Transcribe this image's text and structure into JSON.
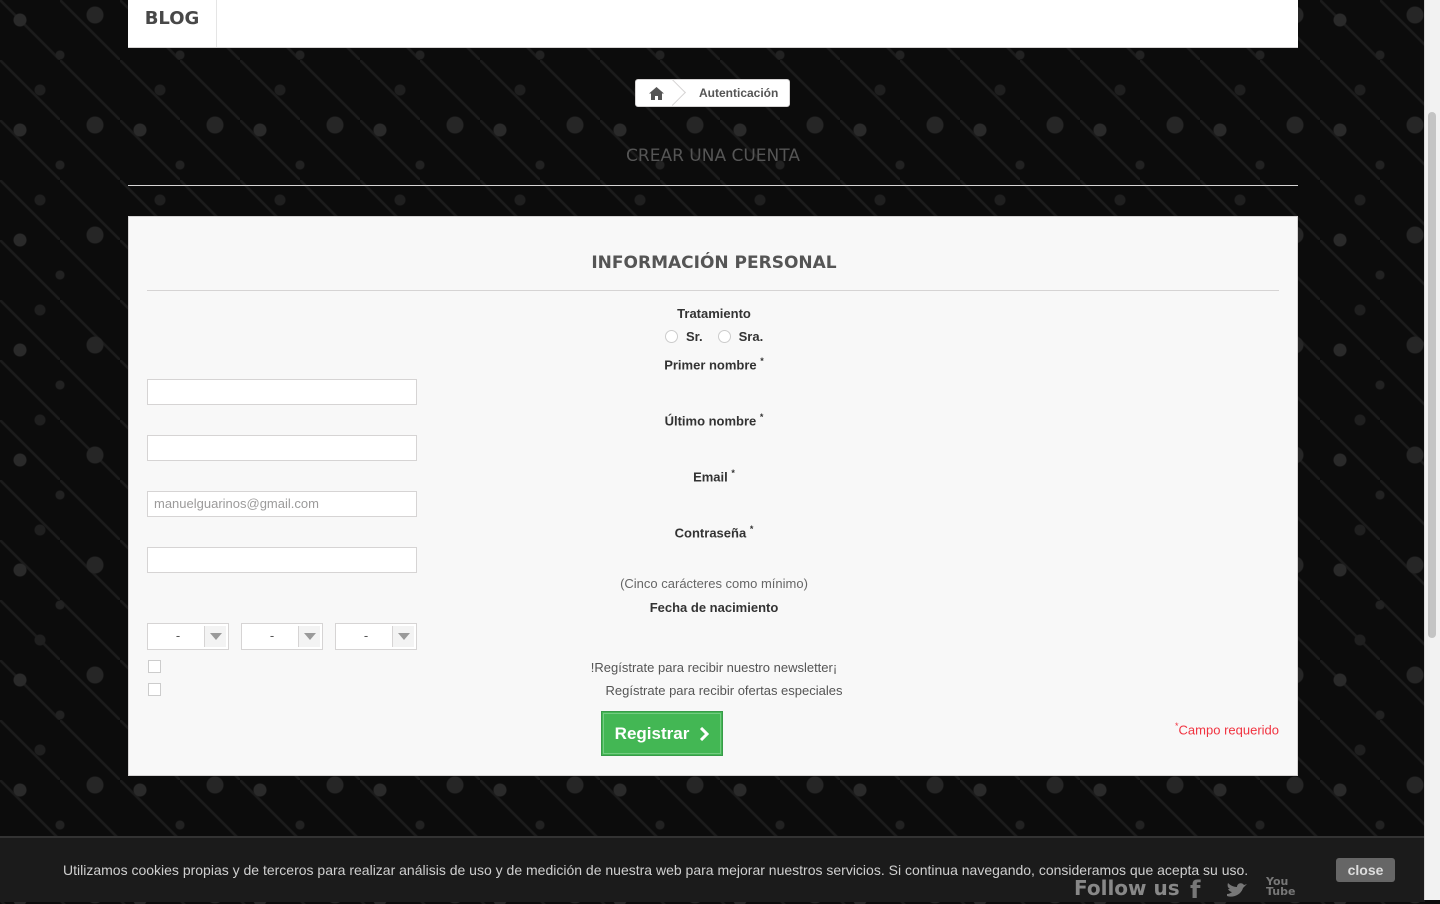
{
  "nav": {
    "blog_label": "BLOG"
  },
  "breadcrumb": {
    "home_icon": "home-icon",
    "current": "Autenticación"
  },
  "page": {
    "heading": "CREAR UNA CUENTA"
  },
  "form": {
    "section_title": "INFORMACIÓN PERSONAL",
    "title_label": "Tratamiento",
    "title_options": [
      "Sr.",
      "Sra."
    ],
    "first_name_label": "Primer nombre",
    "last_name_label": "Último nombre",
    "email_label": "Email",
    "email_value": "manuelguarinos@gmail.com",
    "password_label": "Contraseña",
    "password_hint": "(Cinco carácteres como mínimo)",
    "birthdate_label": "Fecha de nacimiento",
    "birthdate_day": "-",
    "birthdate_month": "-",
    "birthdate_year": "-",
    "newsletter_label": "!Regístrate para recibir nuestro newsletter¡",
    "offers_label": "Regístrate para recibir ofertas especiales",
    "submit_label": "Registrar",
    "required_mark": "*",
    "required_note": "Campo requerido"
  },
  "cookie": {
    "text": "Utilizamos cookies propias y de terceros para realizar análisis de uso y de medición de nuestra web para mejorar nuestros servicios. Si continua navegando, consideramos que acepta su uso.",
    "close_label": "close"
  },
  "footer": {
    "follow_label": "Follow us",
    "social_icons": [
      "facebook-icon",
      "twitter-icon",
      "youtube-icon"
    ]
  },
  "colors": {
    "accent_green": "#43b754",
    "required_red": "#f13340"
  }
}
